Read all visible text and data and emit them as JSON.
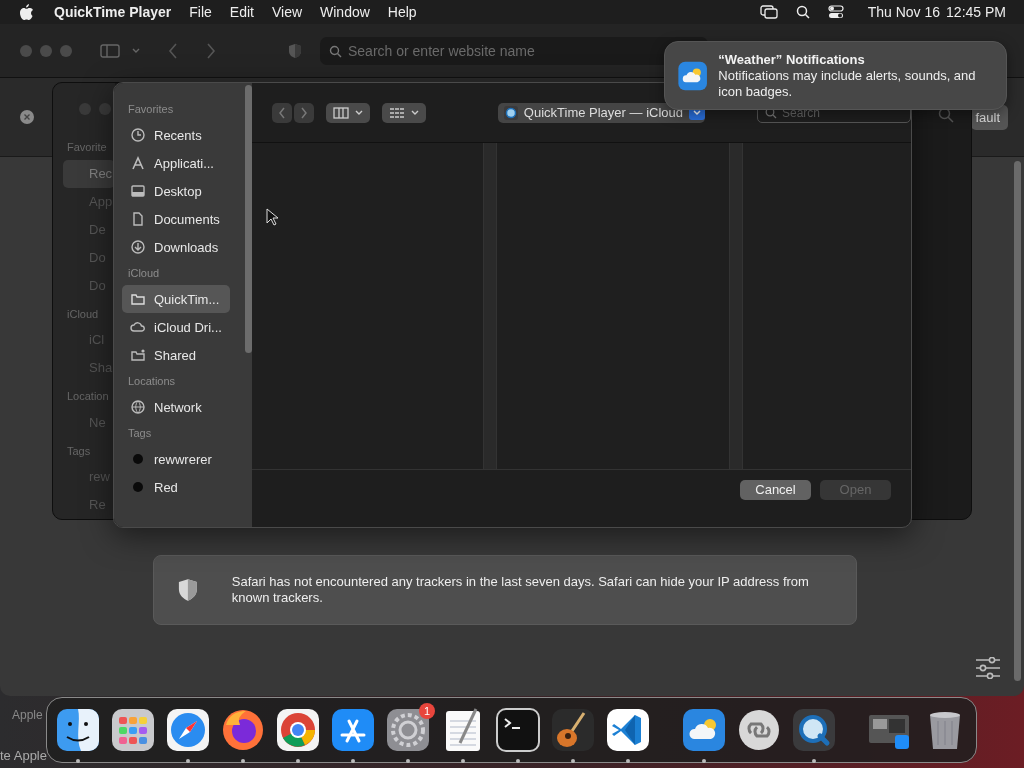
{
  "menu_bar": {
    "app": "QuickTime Player",
    "menus": [
      "File",
      "Edit",
      "View",
      "Window",
      "Help"
    ],
    "date": "Thu Nov 16",
    "time": "12:45 PM"
  },
  "browser": {
    "address_placeholder": "Search or enter website name",
    "right_button": "fault",
    "privacy_text": "Safari has not encountered any trackers in the last seven days. Safari can hide your IP address from known trackers.",
    "background_sidebar": [
      {
        "kind": "heading",
        "text": "Favorite"
      },
      {
        "kind": "item",
        "text": "Rec",
        "selected": true
      },
      {
        "kind": "item",
        "text": "App",
        "selected": false
      },
      {
        "kind": "item",
        "text": "De",
        "selected": false
      },
      {
        "kind": "item",
        "text": "Do",
        "selected": false
      },
      {
        "kind": "item",
        "text": "Do",
        "selected": false
      },
      {
        "kind": "heading",
        "text": "iCloud"
      },
      {
        "kind": "item",
        "text": "iCl",
        "selected": false
      },
      {
        "kind": "item",
        "text": "Sha",
        "selected": false
      },
      {
        "kind": "heading",
        "text": "Location"
      },
      {
        "kind": "item",
        "text": "Ne",
        "selected": false
      },
      {
        "kind": "heading",
        "text": "Tags"
      },
      {
        "kind": "item",
        "text": "rew",
        "selected": false
      },
      {
        "kind": "item",
        "text": "Re",
        "selected": false
      }
    ]
  },
  "open_dialog": {
    "location": "QuickTime Player — iCloud",
    "search_placeholder": "Search",
    "sidebar": [
      {
        "heading": "Favorites",
        "items": [
          {
            "label": "Recents",
            "kind": "clock",
            "selected": false
          },
          {
            "label": "Applicati...",
            "kind": "apps",
            "selected": false
          },
          {
            "label": "Desktop",
            "kind": "desktop",
            "selected": false
          },
          {
            "label": "Documents",
            "kind": "document",
            "selected": false
          },
          {
            "label": "Downloads",
            "kind": "download",
            "selected": false
          }
        ]
      },
      {
        "heading": "iCloud",
        "items": [
          {
            "label": "QuickTim...",
            "kind": "folder",
            "selected": true
          },
          {
            "label": "iCloud Dri...",
            "kind": "cloud",
            "selected": false
          },
          {
            "label": "Shared",
            "kind": "shared",
            "selected": false
          }
        ]
      },
      {
        "heading": "Locations",
        "items": [
          {
            "label": "Network",
            "kind": "network",
            "selected": false
          }
        ]
      },
      {
        "heading": "Tags",
        "items": [
          {
            "label": "rewwrerer",
            "kind": "tag",
            "color": "#0a0a0a",
            "selected": false
          },
          {
            "label": "Red",
            "kind": "tag",
            "color": "#0a0a0a",
            "selected": false
          }
        ]
      }
    ],
    "buttons": [
      {
        "label": "Cancel",
        "disabled": false
      },
      {
        "label": "Open",
        "disabled": true
      }
    ]
  },
  "notification": {
    "title": "“Weather” Notifications",
    "body": "Notifications may include alerts, sounds, and icon badges."
  },
  "dock": {
    "apps": [
      {
        "kind": "finder",
        "running": true
      },
      {
        "kind": "launchpad",
        "running": false
      },
      {
        "kind": "safari",
        "running": true
      },
      {
        "kind": "firefox",
        "running": true
      },
      {
        "kind": "chrome",
        "running": true
      },
      {
        "kind": "appstore",
        "running": true
      },
      {
        "kind": "settings",
        "running": true,
        "badge": "1"
      },
      {
        "kind": "textedit",
        "running": true
      },
      {
        "kind": "terminal",
        "running": true
      },
      {
        "kind": "guitar",
        "running": true
      },
      {
        "kind": "vscode",
        "running": true
      },
      {
        "kind": "separator"
      },
      {
        "kind": "weather",
        "running": true
      },
      {
        "kind": "cloudapp",
        "running": false
      },
      {
        "kind": "quicktime",
        "running": true
      },
      {
        "kind": "separator"
      },
      {
        "kind": "stack",
        "running": false
      },
      {
        "kind": "trash",
        "running": false
      }
    ]
  },
  "desktop_texts": [
    "Apple",
    "te Apple"
  ]
}
